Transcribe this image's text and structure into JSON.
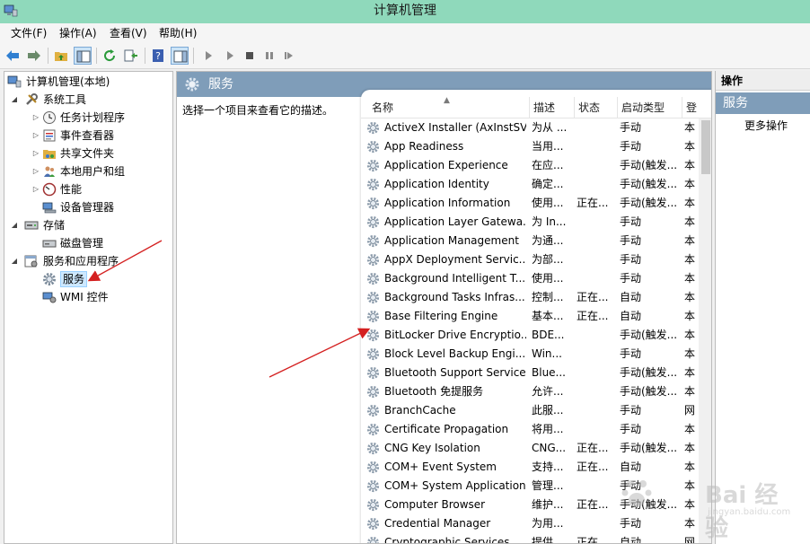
{
  "window": {
    "title": "计算机管理"
  },
  "menu": [
    "文件(F)",
    "操作(A)",
    "查看(V)",
    "帮助(H)"
  ],
  "tree": {
    "root": "计算机管理(本地)",
    "system_tools": "系统工具",
    "task_scheduler": "任务计划程序",
    "event_viewer": "事件查看器",
    "shared_folders": "共享文件夹",
    "local_users": "本地用户和组",
    "performance": "性能",
    "device_manager": "设备管理器",
    "storage": "存储",
    "disk_management": "磁盘管理",
    "services_apps": "服务和应用程序",
    "services": "服务",
    "wmi": "WMI 控件"
  },
  "center": {
    "title": "服务",
    "description_prompt": "选择一个项目来查看它的描述。",
    "columns": [
      "名称",
      "描述",
      "状态",
      "启动类型",
      "登"
    ],
    "services": [
      {
        "name": "ActiveX Installer (AxInstSV)",
        "desc": "为从 ...",
        "status": "",
        "startup": "手动",
        "logon": "本"
      },
      {
        "name": "App Readiness",
        "desc": "当用...",
        "status": "",
        "startup": "手动",
        "logon": "本"
      },
      {
        "name": "Application Experience",
        "desc": "在应...",
        "status": "",
        "startup": "手动(触发...",
        "logon": "本"
      },
      {
        "name": "Application Identity",
        "desc": "确定...",
        "status": "",
        "startup": "手动(触发...",
        "logon": "本"
      },
      {
        "name": "Application Information",
        "desc": "使用...",
        "status": "正在...",
        "startup": "手动(触发...",
        "logon": "本"
      },
      {
        "name": "Application Layer Gatewa...",
        "desc": "为 In...",
        "status": "",
        "startup": "手动",
        "logon": "本"
      },
      {
        "name": "Application Management",
        "desc": "为通...",
        "status": "",
        "startup": "手动",
        "logon": "本"
      },
      {
        "name": "AppX Deployment Servic...",
        "desc": "为部...",
        "status": "",
        "startup": "手动",
        "logon": "本"
      },
      {
        "name": "Background Intelligent T...",
        "desc": "使用...",
        "status": "",
        "startup": "手动",
        "logon": "本"
      },
      {
        "name": "Background Tasks Infras...",
        "desc": "控制...",
        "status": "正在...",
        "startup": "自动",
        "logon": "本"
      },
      {
        "name": "Base Filtering Engine",
        "desc": "基本...",
        "status": "正在...",
        "startup": "自动",
        "logon": "本"
      },
      {
        "name": "BitLocker Drive Encryptio...",
        "desc": "BDE...",
        "status": "",
        "startup": "手动(触发...",
        "logon": "本"
      },
      {
        "name": "Block Level Backup Engi...",
        "desc": "Win...",
        "status": "",
        "startup": "手动",
        "logon": "本"
      },
      {
        "name": "Bluetooth Support Service",
        "desc": "Blue...",
        "status": "",
        "startup": "手动(触发...",
        "logon": "本"
      },
      {
        "name": "Bluetooth 免提服务",
        "desc": "允许...",
        "status": "",
        "startup": "手动(触发...",
        "logon": "本"
      },
      {
        "name": "BranchCache",
        "desc": "此服...",
        "status": "",
        "startup": "手动",
        "logon": "网"
      },
      {
        "name": "Certificate Propagation",
        "desc": "将用...",
        "status": "",
        "startup": "手动",
        "logon": "本"
      },
      {
        "name": "CNG Key Isolation",
        "desc": "CNG...",
        "status": "正在...",
        "startup": "手动(触发...",
        "logon": "本"
      },
      {
        "name": "COM+ Event System",
        "desc": "支持...",
        "status": "正在...",
        "startup": "自动",
        "logon": "本"
      },
      {
        "name": "COM+ System Application",
        "desc": "管理...",
        "status": "",
        "startup": "手动",
        "logon": "本"
      },
      {
        "name": "Computer Browser",
        "desc": "维护...",
        "status": "正在...",
        "startup": "手动(触发...",
        "logon": "本"
      },
      {
        "name": "Credential Manager",
        "desc": "为用...",
        "status": "",
        "startup": "手动",
        "logon": "本"
      },
      {
        "name": "Cryptographic Services",
        "desc": "提供...",
        "status": "正在...",
        "startup": "自动",
        "logon": "网"
      }
    ]
  },
  "actions": {
    "title": "操作",
    "section": "服务",
    "more": "更多操作"
  },
  "watermark": {
    "text": "Bai 经验",
    "sub": "jingyan.baidu.com"
  },
  "colors": {
    "titlebar": "#8fd9bb",
    "header_band": "#7f9db9",
    "annotation_arrow": "#d42020"
  }
}
